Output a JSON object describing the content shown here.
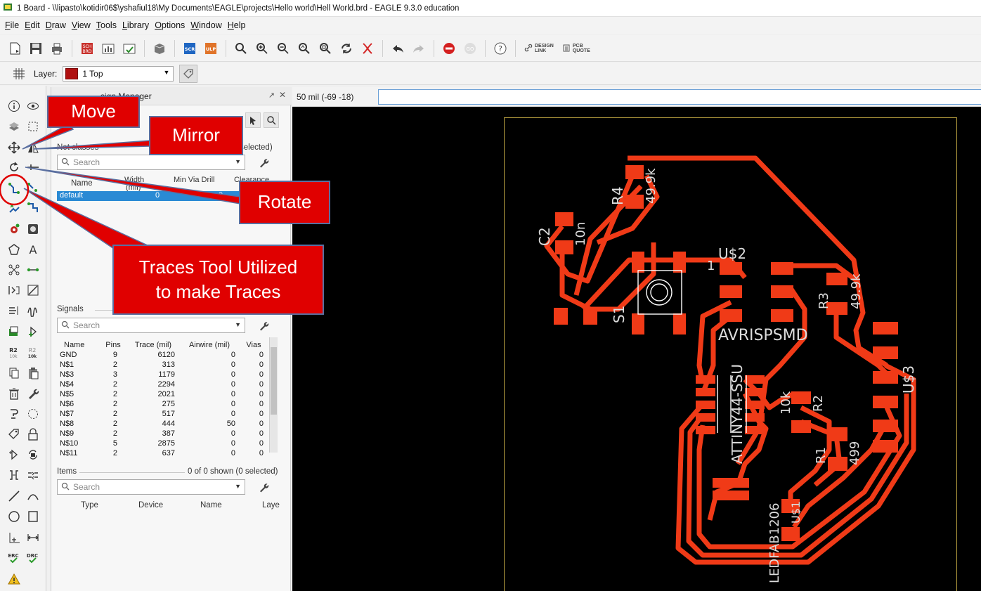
{
  "window": {
    "title": "1 Board - \\\\lipasto\\kotidir06$\\yshafiul18\\My Documents\\EAGLE\\projects\\Hello world\\Hell World.brd - EAGLE 9.3.0 education"
  },
  "menu": [
    {
      "key": "F",
      "rest": "ile"
    },
    {
      "key": "E",
      "rest": "dit"
    },
    {
      "key": "D",
      "rest": "raw"
    },
    {
      "key": "V",
      "rest": "iew"
    },
    {
      "key": "T",
      "rest": "ools"
    },
    {
      "key": "L",
      "rest": "ibrary"
    },
    {
      "key": "O",
      "rest": "ptions"
    },
    {
      "key": "W",
      "rest": "indow"
    },
    {
      "key": "H",
      "rest": "elp"
    }
  ],
  "toolbar": {
    "design_link_1": "DESIGN",
    "design_link_2": "LINK",
    "pcb_quote_1": "PCB",
    "pcb_quote_2": "QUOTE"
  },
  "layer": {
    "label": "Layer:",
    "selected": "1 Top",
    "selected_color": "#b01010"
  },
  "panel": {
    "title": "sign Manager",
    "search_placeholder": "Search",
    "net_classes": {
      "label": "Net classes",
      "selected": "selected)",
      "columns": [
        "Name",
        "Width",
        "(mil)",
        "Min Via Drill",
        "Clearance"
      ],
      "rows": [
        {
          "name": "default",
          "width": "0",
          "drill": "0"
        }
      ]
    },
    "signals": {
      "label": "Signals",
      "columns": [
        "Name",
        "Pins",
        "Trace (mil)",
        "Airwire (mil)",
        "Vias"
      ],
      "rows": [
        {
          "name": "GND",
          "pins": "9",
          "trace": "6120",
          "airwire": "0",
          "vias": "0"
        },
        {
          "name": "N$1",
          "pins": "2",
          "trace": "313",
          "airwire": "0",
          "vias": "0"
        },
        {
          "name": "N$3",
          "pins": "3",
          "trace": "1179",
          "airwire": "0",
          "vias": "0"
        },
        {
          "name": "N$4",
          "pins": "2",
          "trace": "2294",
          "airwire": "0",
          "vias": "0"
        },
        {
          "name": "N$5",
          "pins": "2",
          "trace": "2021",
          "airwire": "0",
          "vias": "0"
        },
        {
          "name": "N$6",
          "pins": "2",
          "trace": "275",
          "airwire": "0",
          "vias": "0"
        },
        {
          "name": "N$7",
          "pins": "2",
          "trace": "517",
          "airwire": "0",
          "vias": "0"
        },
        {
          "name": "N$8",
          "pins": "2",
          "trace": "444",
          "airwire": "50",
          "vias": "0"
        },
        {
          "name": "N$9",
          "pins": "2",
          "trace": "387",
          "airwire": "0",
          "vias": "0"
        },
        {
          "name": "N$10",
          "pins": "5",
          "trace": "2875",
          "airwire": "0",
          "vias": "0"
        },
        {
          "name": "N$11",
          "pins": "2",
          "trace": "637",
          "airwire": "0",
          "vias": "0"
        }
      ]
    },
    "items": {
      "label": "Items",
      "shown": "0 of 0 shown (0 selected)",
      "columns": [
        "Type",
        "Device",
        "Name",
        "Laye"
      ]
    }
  },
  "status": {
    "coordinates": "50 mil (-69 -18)",
    "command": ""
  },
  "board": {
    "trace_color": "#f03a17",
    "labels": [
      "R4",
      "49.9k",
      "C2",
      "10n",
      "S1",
      "U$2",
      "AVRISPSMD",
      "ATTINY44-SSU",
      "R3",
      "49.9k",
      "U$3",
      "10k",
      "R2",
      "R1",
      "499",
      "LEDFAB1206",
      "U$1",
      "1"
    ]
  },
  "annotations": {
    "move": "Move",
    "mirror": "Mirror",
    "rotate": "Rotate",
    "traces_1": "Traces Tool Utilized",
    "traces_2": "to make Traces",
    "callout_color": "#e00000"
  }
}
